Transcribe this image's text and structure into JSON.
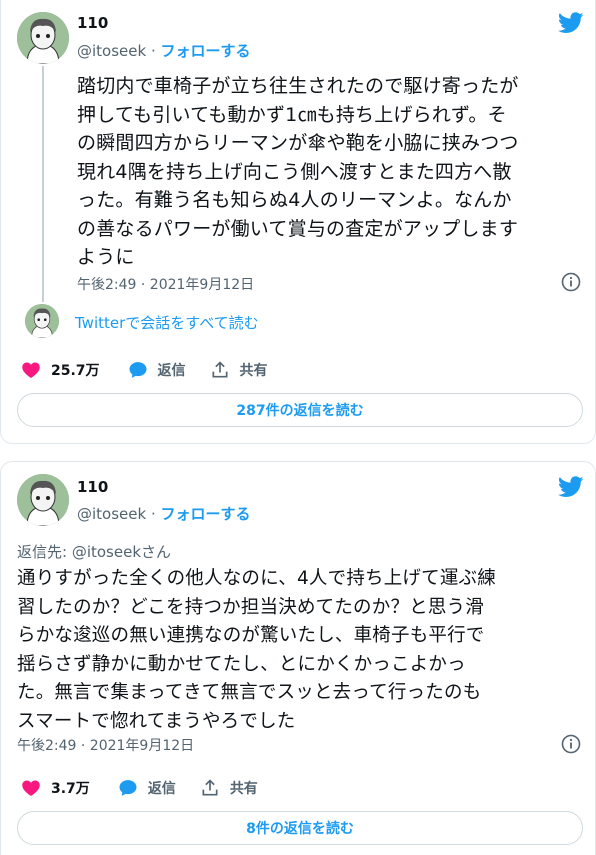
{
  "tweet1": {
    "name": "110",
    "handle": "@itoseek",
    "separator": " · ",
    "follow_label": "フォローする",
    "text_lines": [
      "踏切内で車椅子が立ち往生されたので駆け寄ったが",
      "押しても引いても動かず1㎝も持ち上げられず。そ",
      "の瞬間四方からリーマンが傘や鞄を小脇に挟みつつ",
      "現れ4隅を持ち上げ向こう側へ渡すとまた四方へ散",
      "った。有難う名も知らぬ4人のリーマンよ。なんか",
      "の善なるパワーが働いて賞与の査定がアップします",
      "ように"
    ],
    "timestamp": "午後2:49 · 2021年9月12日",
    "conversation_link": "Twitterで会話をすべて読む",
    "likes": "25.7万",
    "reply_label": "返信",
    "share_label": "共有",
    "read_replies": "287件の返信を読む"
  },
  "tweet2": {
    "name": "110",
    "handle": "@itoseek",
    "separator": " · ",
    "follow_label": "フォローする",
    "reply_to": "返信先: @itoseekさん",
    "text_lines": [
      "通りすがった全くの他人なのに、4人で持ち上げて運ぶ練",
      "習したのか？どこを持つか担当決めてたのか？と思う滑",
      "らかな逡巡の無い連携なのが驚いたし、車椅子も平行で",
      "揺らさず静かに動かせてたし、とにかくかっこよかっ",
      "た。無言で集まってきて無言でスッと去って行ったのも",
      "スマートで惚れてまうやろでした"
    ],
    "timestamp": "午後2:49 · 2021年9月12日",
    "likes": "3.7万",
    "reply_label": "返信",
    "share_label": "共有",
    "read_replies": "8件の返信を読む"
  },
  "colors": {
    "twitter_blue": "#1d9bf0",
    "heart": "#f91880",
    "text": "#0f1419",
    "secondary": "#536471",
    "border": "#cfd9de"
  },
  "icons": [
    "twitter-bird-icon",
    "info-icon",
    "heart-icon",
    "comment-icon",
    "share-icon"
  ]
}
